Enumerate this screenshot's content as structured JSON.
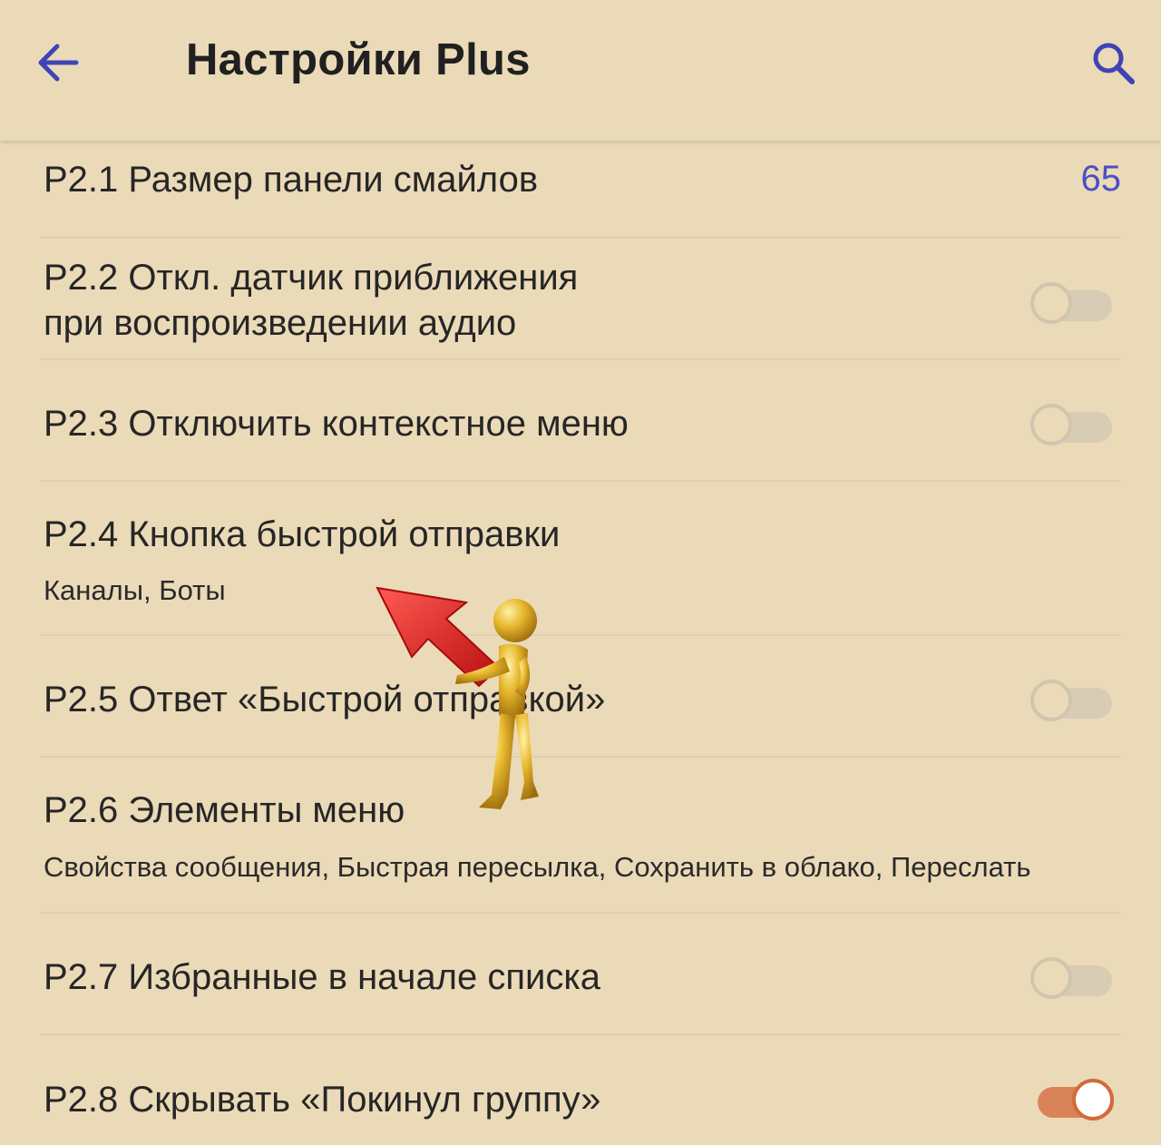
{
  "header": {
    "title": "Настройки Plus",
    "back_icon": "arrow-left-icon",
    "search_icon": "search-icon",
    "accent_color": "#3f44b5"
  },
  "settings": [
    {
      "title": "P2.1 Размер панели смайлов",
      "value": "65"
    },
    {
      "title_line1": "P2.2 Откл. датчик приближения",
      "title_line2": "при воспроизведении аудио",
      "enabled": false
    },
    {
      "title": "P2.3 Отключить контекстное меню",
      "enabled": false
    },
    {
      "title": "P2.4 Кнопка быстрой отправки",
      "subtitle": "Каналы, Боты"
    },
    {
      "title": "P2.5 Ответ «Быстрой отправкой»",
      "enabled": false
    },
    {
      "title": "P2.6 Элементы меню",
      "subtitle": "Свойства сообщения, Быстрая пересылка, Сохранить в облако, Переслать"
    },
    {
      "title": "P2.7 Избранные в начале списка",
      "enabled": false
    },
    {
      "title": "P2.8 Скрывать «Покинул группу»",
      "enabled": true
    }
  ],
  "overlay": {
    "image": "gold-figure-with-red-arrow",
    "arrow_color": "#e02020",
    "figure_color": "#e3b12c"
  }
}
